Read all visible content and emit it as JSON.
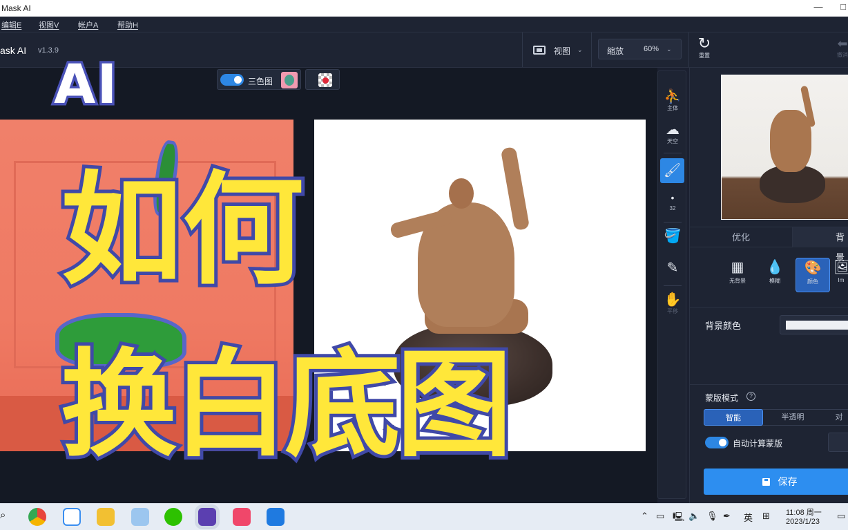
{
  "window": {
    "title": "Mask AI",
    "maximize_glyph": "□"
  },
  "menu": [
    {
      "label": "编辑E"
    },
    {
      "label": "视图V"
    },
    {
      "label": "帐户A"
    },
    {
      "label": "帮助H"
    }
  ],
  "toolbar": {
    "brand": "ask AI",
    "version": "v1.3.9",
    "view_label": "视图",
    "zoom_label": "缩放",
    "zoom_value": "60%",
    "reset_label": "重置",
    "undo_label": "撤消"
  },
  "canvas": {
    "tricolor_label": "三色图",
    "tricolor_enabled": true
  },
  "overlay": {
    "badge": "AI",
    "line1": "如何",
    "line2": "换白底图"
  },
  "tools": [
    {
      "name": "subject",
      "icon": "person-icon",
      "label": "主体",
      "glyph": "⛹"
    },
    {
      "name": "sky",
      "icon": "cloud-icon",
      "label": "天空",
      "glyph": "☁"
    },
    {
      "name": "brush",
      "icon": "brush-settings-icon",
      "label": "",
      "glyph": "🖌"
    },
    {
      "name": "brush-size",
      "icon": "dot-icon",
      "label": "32",
      "glyph": "•"
    },
    {
      "name": "fill",
      "icon": "paint-bucket-icon",
      "label": "",
      "glyph": "🪣"
    },
    {
      "name": "eyedropper",
      "icon": "eyedropper-icon",
      "label": "",
      "glyph": "✎"
    },
    {
      "name": "pan",
      "icon": "hand-icon",
      "label": "平移",
      "glyph": "✋"
    }
  ],
  "panel": {
    "tabs": [
      {
        "label": "优化",
        "active": false
      },
      {
        "label": "背景",
        "active": true
      }
    ],
    "modes": [
      {
        "label": "无背景",
        "icon": "checker-icon",
        "glyph": "▦",
        "active": false
      },
      {
        "label": "模糊",
        "icon": "drop-icon",
        "glyph": "💧",
        "active": false
      },
      {
        "label": "颜色",
        "icon": "palette-icon",
        "glyph": "🎨",
        "active": true
      },
      {
        "label": "Im",
        "icon": "image-icon",
        "glyph": "🖼",
        "active": false
      }
    ],
    "bg_color_label": "背景颜色",
    "bg_color_value": "#eef0f4",
    "mask_mode_label": "蒙版模式",
    "mask_modes": [
      {
        "label": "智能",
        "active": true
      },
      {
        "label": "半透明",
        "active": false
      },
      {
        "label": "对",
        "active": false
      }
    ],
    "auto_mask_label": "自动计算蒙版",
    "auto_mask_enabled": true,
    "save_label": "保存"
  },
  "taskbar": {
    "apps": [
      {
        "name": "chrome",
        "color": "#e8453c"
      },
      {
        "name": "baidu-netdisk",
        "color": "#3a8ef0"
      },
      {
        "name": "file-explorer",
        "color": "#f2c032"
      },
      {
        "name": "notes",
        "color": "#7fb5e8"
      },
      {
        "name": "wechat",
        "color": "#2dc100"
      },
      {
        "name": "mask-ai",
        "color": "#5b3fb0"
      },
      {
        "name": "meitu",
        "color": "#f0476a"
      },
      {
        "name": "recorder",
        "color": "#1f7ae0"
      }
    ],
    "ime": "英",
    "time": "11:08 周一",
    "date": "2023/1/23"
  }
}
